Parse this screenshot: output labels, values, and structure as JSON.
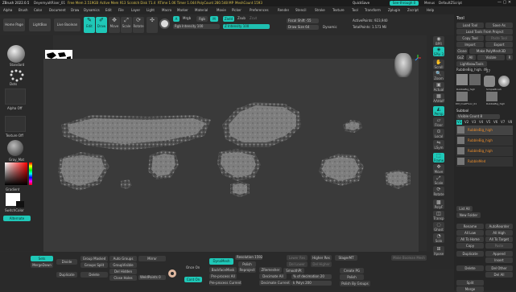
{
  "titlebar": {
    "app": "ZBrush 2022.0.5",
    "doc": "DeyemyaItRiser_01",
    "stats": [
      "Free Mem 2.519GB",
      "Active Mem 913",
      "Scratch Disk 71.4",
      "RTime 1.06 Timer 1.044",
      "PolyCount 280.548 MP",
      "MeshCount 1593"
    ],
    "quicksave": "QuickSave",
    "see_through": "See-through 0",
    "menus_label": "Menus",
    "default_script": "DefaultZScript"
  },
  "menubar": [
    "Alpha",
    "Brush",
    "Color",
    "Document",
    "Draw",
    "Dynamics",
    "Edit",
    "File",
    "Layer",
    "Light",
    "Macro",
    "Marker",
    "Material",
    "Movie",
    "Picker",
    "Preferences",
    "Render",
    "Stencil",
    "Stroke",
    "Texture",
    "Tool",
    "Transform",
    "Zplugin",
    "Zscript",
    "Help"
  ],
  "toprow": {
    "home_page": "Home Page",
    "lightbox": "LightBox",
    "live_boolean": "Live Boolean",
    "edit": "Edit",
    "draw": "Draw",
    "move": "Move",
    "scale": "Scale",
    "rotate": "Rotate",
    "a_label": "A",
    "mrgb": "Mrgb",
    "rgb": "Rgb",
    "m": "M",
    "zadd": "Zadd",
    "zsub": "Zsub",
    "zcut": "Zcut",
    "rgb_intensity": "Rgb Intensity 100",
    "z_intensity": "Z Intensity 100",
    "focal_shift": "Focal Shift -55",
    "draw_size": "Draw Size 64",
    "dynamic": "Dynamic",
    "active_points": "ActivePoints: 923,940",
    "total_points": "TotalPoints: 1.573 Mil"
  },
  "leftpanel": {
    "brush": "Standard",
    "stroke": "Dots",
    "alpha": "Alpha Off",
    "texture": "Texture Off",
    "material": "Gray_Mat",
    "gradient": "Gradient",
    "switch_color": "SwitchColor",
    "alternate": "Alternate"
  },
  "rightshelf": [
    "BPR",
    "SPix 3",
    "Scroll",
    "Zoom",
    "Actual",
    "AAHalf",
    "Persp",
    "Floor",
    "Local",
    "LSym",
    "Frame",
    "Move",
    "Scale",
    "Rotate",
    "PolyF",
    "Transp",
    "Ghost",
    "Solo",
    "Xpose"
  ],
  "rightpanel": {
    "title": "Tool",
    "load_tool": "Load Tool",
    "save_as": "Save As",
    "load_tools_project": "Load Tools From Project",
    "copy_tool": "Copy Tool",
    "paste_tool": "Paste Tool",
    "import": "Import",
    "export": "Export",
    "clone": "Clone",
    "make_polymesh": "Make PolyMesh3D",
    "goz": "GoZ",
    "all": "All",
    "visible": "Visible",
    "r": "R",
    "lightbox_tools": "Lightbox▸Tools",
    "current_tool": "RubbleBig_high. 49",
    "tool_count": "27",
    "thumbs": [
      "RubbleBig_high",
      "SimpleBrush",
      "DM_DustFloor_01",
      "RubbleBig_high"
    ],
    "subtool": "Subtool",
    "visible_count": "Visible Count 8",
    "v_tabs": [
      "V1",
      "V2",
      "V3",
      "V4",
      "V5",
      "V6",
      "V7",
      "V8"
    ],
    "subtools": [
      "RubbleBig_high",
      "RubbleBig_high",
      "RubbleBig_high",
      "RubbleMed"
    ],
    "list_all": "List All",
    "new_folder": "New Folder",
    "rename": "Rename",
    "auto_reorder": "AutoReorder",
    "all_low": "All Low",
    "all_high": "All High",
    "all_to_home": "All To Home",
    "all_to_target": "All To Target",
    "copy": "Copy",
    "paste": "Paste",
    "duplicate": "Duplicate",
    "append": "Append",
    "insert": "Insert",
    "delete": "Delete",
    "del_other": "Del Other",
    "del_all": "Del All",
    "split": "Split",
    "merge": "Merge"
  },
  "bottom": {
    "sets": "Sets",
    "merge_down": "MergeDown",
    "divide": "Divide",
    "duplicate": "Duplicate",
    "group_masked": "Group Masked",
    "groups_split": "Groups Split",
    "delete": "Delete",
    "auto_groups": "Auto Groups",
    "group_visible": "GroupVisible",
    "del_hidden": "Del Hidden",
    "close_holes": "Close Holes",
    "mirror": "Mirror",
    "weld_points": "WeldPoints 0",
    "once_on": "Once On",
    "cont_on": "Cont On",
    "dynamesh": "DynaMesh",
    "resolution": "Resolution 1592",
    "backface_mask": "BackfaceMask",
    "pre_process_all": "Pre-process All",
    "pre_process_current": "Pre-process Current",
    "polish": "Polish",
    "reproject": "Reproject",
    "zremesher": "ZRemesher",
    "decimate_all": "Decimate All",
    "decimate_current": "Decimate Current",
    "lower_res": "Lower Res",
    "higher_res": "Higher Res",
    "smooth_pt": "SmoothPt",
    "pct_decimation": "% of decimation 20",
    "k_polys": "k Polys 200",
    "stager": "StagerMT",
    "create_pg": "Create PG",
    "polish_label": "Polish",
    "polish_by_groups": "Polish By Groups",
    "del_lower": "Del Lower",
    "del_higher": "Del Higher",
    "make_boolean": "Make Boolean Mesh"
  }
}
